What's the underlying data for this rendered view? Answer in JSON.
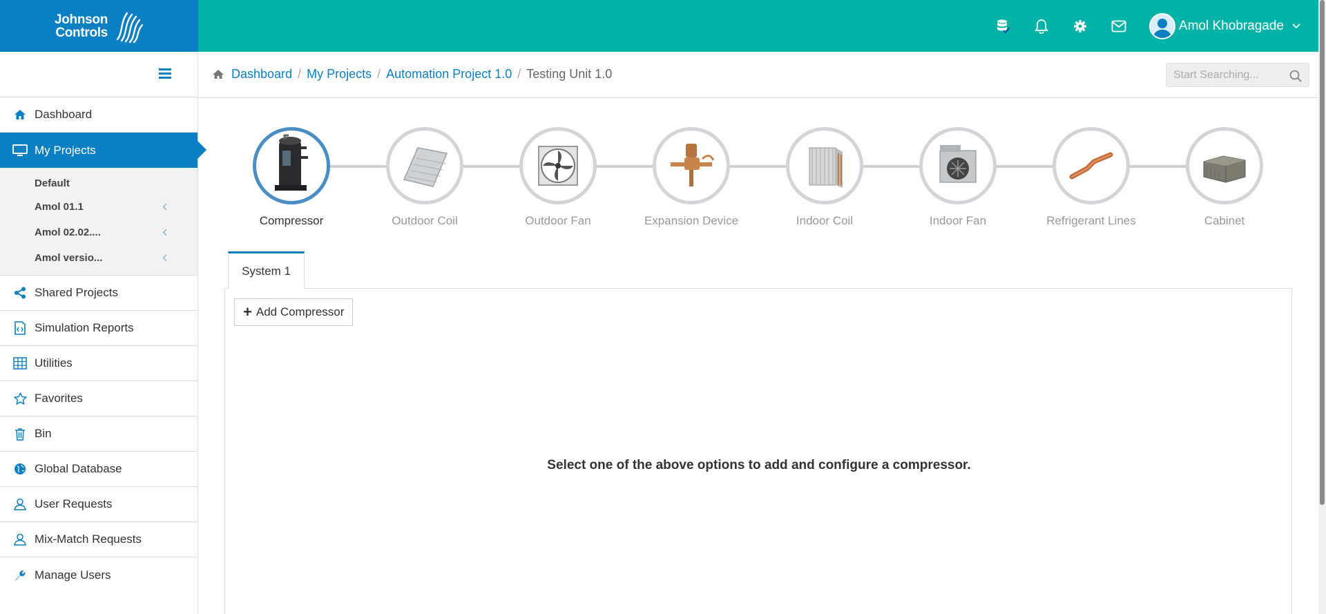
{
  "brand": {
    "line1": "Johnson",
    "line2": "Controls"
  },
  "header": {
    "icons": [
      "database-check-icon",
      "bell-icon",
      "gear-icon",
      "mail-icon"
    ],
    "user_name": "Amol Khobragade"
  },
  "sidebar": {
    "items": [
      {
        "label": "Dashboard",
        "icon": "home-icon"
      },
      {
        "label": "My Projects",
        "icon": "monitor-icon",
        "active": true
      },
      {
        "label": "Shared Projects",
        "icon": "share-icon"
      },
      {
        "label": "Simulation Reports",
        "icon": "code-file-icon"
      },
      {
        "label": "Utilities",
        "icon": "grid-icon"
      },
      {
        "label": "Favorites",
        "icon": "star-icon"
      },
      {
        "label": "Bin",
        "icon": "trash-icon"
      },
      {
        "label": "Global Database",
        "icon": "globe-icon"
      },
      {
        "label": "User Requests",
        "icon": "user-icon"
      },
      {
        "label": "Mix-Match Requests",
        "icon": "user-icon"
      },
      {
        "label": "Manage Users",
        "icon": "wrench-icon"
      }
    ],
    "projects": [
      {
        "label": "Default"
      },
      {
        "label": "Amol 01.1"
      },
      {
        "label": "Amol 02.02...."
      },
      {
        "label": "Amol versio..."
      }
    ]
  },
  "breadcrumb": {
    "items": [
      "Dashboard",
      "My Projects",
      "Automation Project 1.0"
    ],
    "current": "Testing Unit 1.0",
    "separator": "/"
  },
  "search": {
    "placeholder": "Start Searching..."
  },
  "steps": [
    {
      "label": "Compressor",
      "active": true
    },
    {
      "label": "Outdoor Coil"
    },
    {
      "label": "Outdoor Fan"
    },
    {
      "label": "Expansion Device"
    },
    {
      "label": "Indoor Coil"
    },
    {
      "label": "Indoor Fan"
    },
    {
      "label": "Refrigerant Lines"
    },
    {
      "label": "Cabinet"
    }
  ],
  "tabs": [
    {
      "label": "System 1"
    }
  ],
  "panel": {
    "add_button": "Add Compressor",
    "empty_message": "Select one of the above options to add and configure a compressor."
  },
  "colors": {
    "brand_blue": "#0a7fc2",
    "teal": "#00b3a6",
    "active_step": "#4a8ec6"
  }
}
